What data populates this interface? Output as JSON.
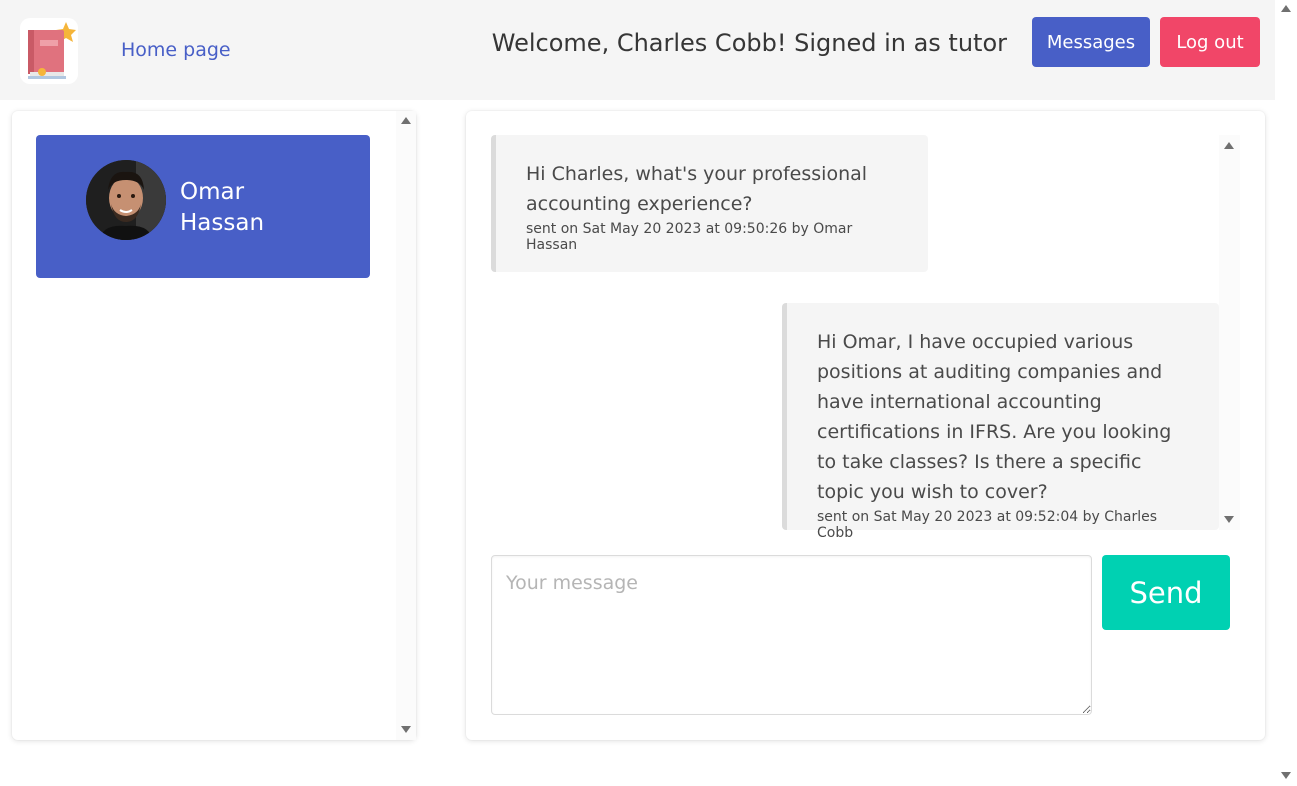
{
  "navbar": {
    "logo_icon": "book-icon",
    "home_link": "Home page",
    "welcome": "Welcome, Charles Cobb! Signed in as tutor",
    "messages_button": "Messages",
    "logout_button": "Log out"
  },
  "colors": {
    "primary": "#485fc7",
    "danger": "#f14668",
    "success": "#00d1b2",
    "navbar_bg": "#f5f5f5",
    "message_bg": "#f5f5f5"
  },
  "conversations": [
    {
      "name_first": "Omar",
      "name_last": "Hassan",
      "avatar_icon": "user-photo-avatar",
      "active": true
    }
  ],
  "chat": {
    "messages": [
      {
        "text": "Hi Charles, what's your professional accounting experience?",
        "meta": "sent on Sat May 20 2023 at 09:50:26 by Omar Hassan",
        "side": "left"
      },
      {
        "text": "Hi Omar, I have occupied various positions at auditing companies and have international accounting certifications in IFRS. Are you looking to take classes? Is there a specific topic you wish to cover?",
        "meta": "sent on Sat May 20 2023 at 09:52:04 by Charles Cobb",
        "side": "right"
      }
    ],
    "input_placeholder": "Your message",
    "input_value": "",
    "send_button": "Send"
  }
}
